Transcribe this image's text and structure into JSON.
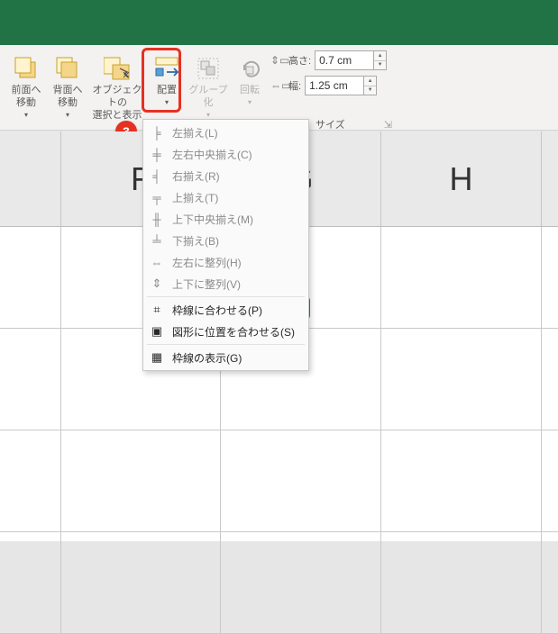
{
  "badge_number": "3",
  "ribbon": {
    "bring_forward": "前面へ\n移動",
    "send_backward": "背面へ\n移動",
    "selection_pane": "オブジェクトの\n選択と表示",
    "align": "配置",
    "group": "グループ化",
    "rotate": "回転"
  },
  "size": {
    "height_label": "高さ:",
    "height_value": "0.7 cm",
    "width_label": "幅:",
    "width_value": "1.25 cm",
    "group_label": "サイズ",
    "launcher": "⇲"
  },
  "menu": {
    "align_left": "左揃え(L)",
    "align_center_h": "左右中央揃え(C)",
    "align_right": "右揃え(R)",
    "align_top": "上揃え(T)",
    "align_middle_v": "上下中央揃え(M)",
    "align_bottom": "下揃え(B)",
    "dist_h": "左右に整列(H)",
    "dist_v": "上下に整列(V)",
    "snap_to_grid": "枠線に合わせる(P)",
    "snap_to_shape": "図形に位置を合わせる(S)",
    "view_gridlines": "枠線の表示(G)"
  },
  "columns": {
    "f": "F",
    "g": "G",
    "h": "H"
  }
}
